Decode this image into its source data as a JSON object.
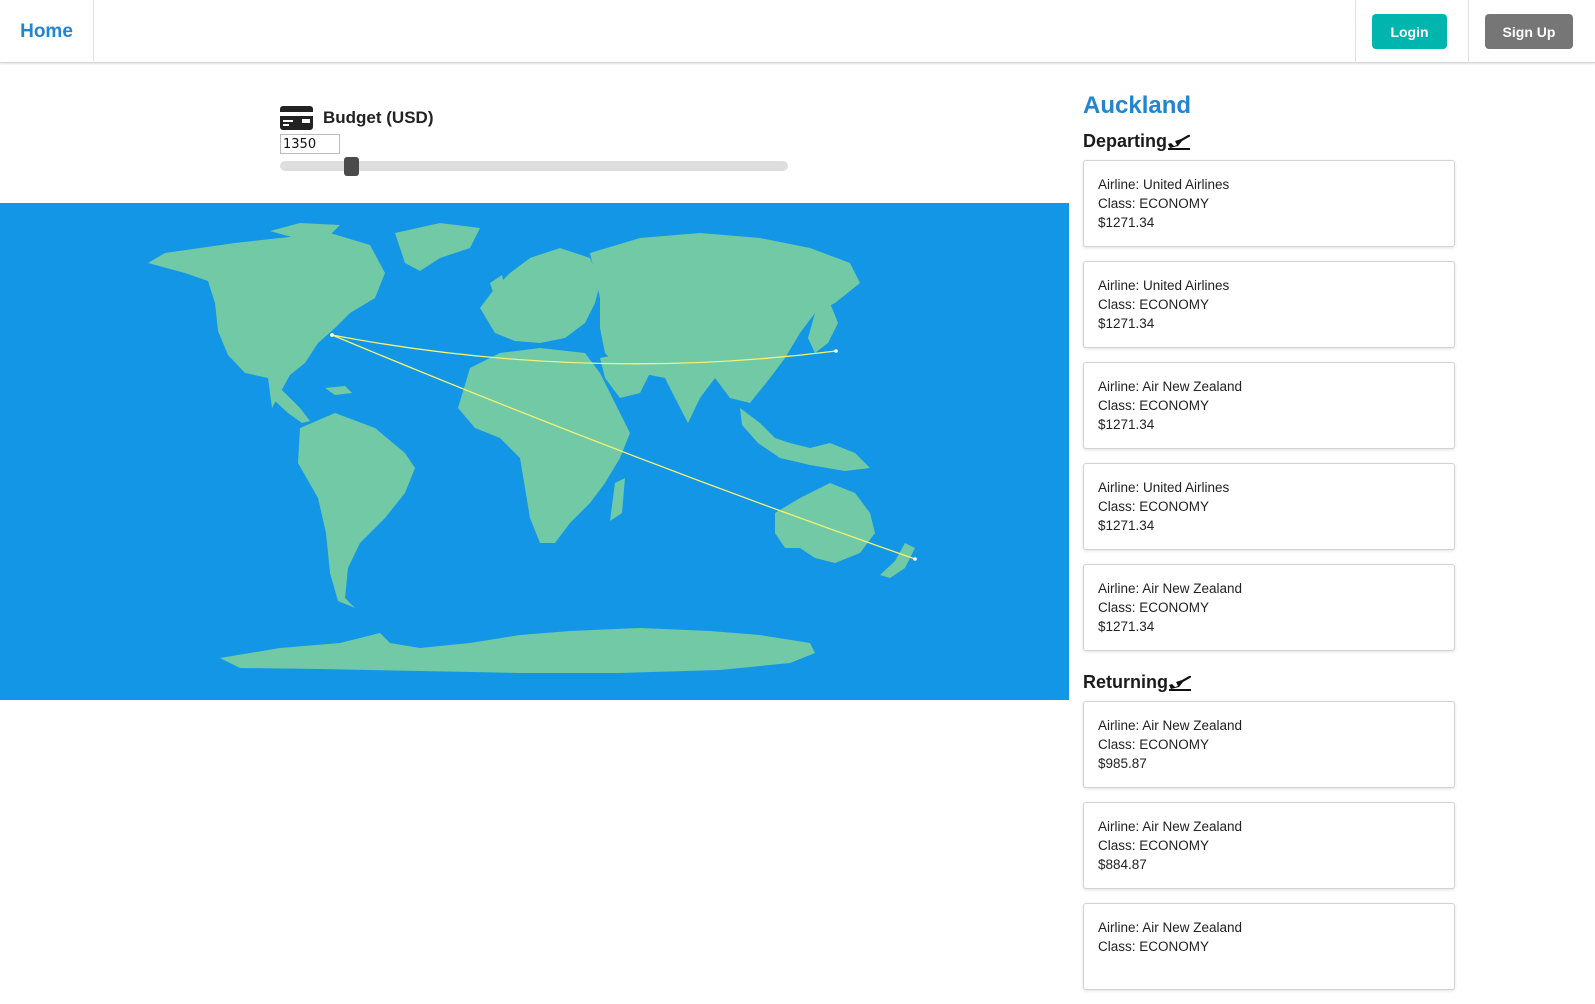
{
  "nav": {
    "home": "Home",
    "login": "Login",
    "signup": "Sign Up"
  },
  "budget": {
    "title": "Budget (USD)",
    "value": "1350",
    "slider_fraction": 0.14,
    "icon": "credit-card-icon"
  },
  "map": {
    "ocean_color": "#1396e6",
    "land_color": "#71c9a6",
    "route_color": "#f4f373",
    "routes": [
      {
        "from": "New York",
        "to": "Tokyo"
      },
      {
        "from": "New York",
        "to": "Auckland"
      }
    ]
  },
  "destination": {
    "city": "Auckland",
    "departing_title": "Departing",
    "returning_title": "Returning",
    "departing": [
      {
        "airline": "Airline: United Airlines",
        "class": "Class: ECONOMY",
        "price": "$1271.34"
      },
      {
        "airline": "Airline: United Airlines",
        "class": "Class: ECONOMY",
        "price": "$1271.34"
      },
      {
        "airline": "Airline: Air New Zealand",
        "class": "Class: ECONOMY",
        "price": "$1271.34"
      },
      {
        "airline": "Airline: United Airlines",
        "class": "Class: ECONOMY",
        "price": "$1271.34"
      },
      {
        "airline": "Airline: Air New Zealand",
        "class": "Class: ECONOMY",
        "price": "$1271.34"
      }
    ],
    "returning": [
      {
        "airline": "Airline: Air New Zealand",
        "class": "Class: ECONOMY",
        "price": "$985.87"
      },
      {
        "airline": "Airline: Air New Zealand",
        "class": "Class: ECONOMY",
        "price": "$884.87"
      },
      {
        "airline": "Airline: Air New Zealand",
        "class": "Class: ECONOMY",
        "price": ""
      }
    ]
  }
}
